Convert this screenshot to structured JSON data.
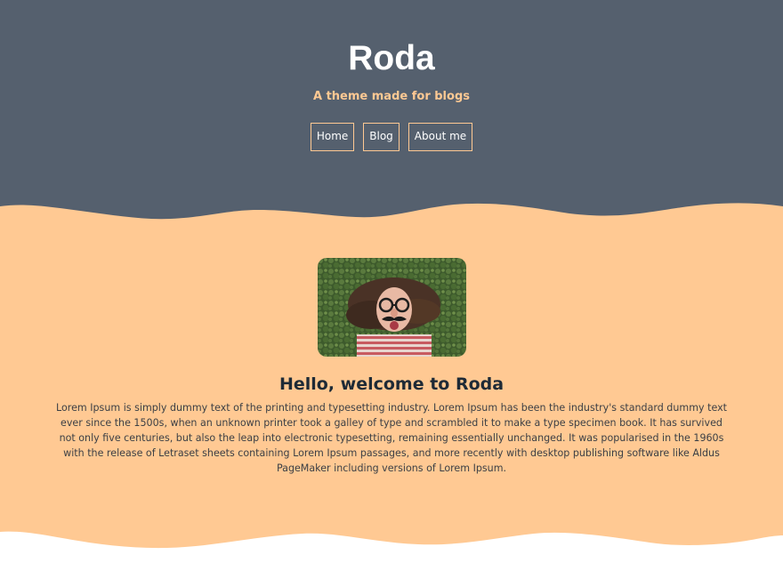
{
  "site": {
    "title": "Roda",
    "tagline": "A theme made for blogs"
  },
  "nav": {
    "items": [
      {
        "label": "Home"
      },
      {
        "label": "Blog"
      },
      {
        "label": "About me"
      }
    ]
  },
  "hero": {
    "heading": "Hello, welcome to Roda",
    "body": "Lorem Ipsum is simply dummy text of the printing and typesetting industry. Lorem Ipsum has been the industry's standard dummy text ever since the 1500s, when an unknown printer took a galley of type and scrambled it to make a type specimen book. It has survived not only five centuries, but also the leap into electronic typesetting, remaining essentially unchanged. It was popularised in the 1960s with the release of Letraset sheets containing Lorem Ipsum passages, and more recently with desktop publishing software like Aldus PageMaker including versions of Lorem Ipsum.",
    "image_icon": "person-in-glasses-disguise-photo"
  },
  "colors": {
    "header_bg": "#55606e",
    "accent": "#ffc993",
    "page_bg": "#ffffff",
    "text_dark": "#1e2a36"
  }
}
